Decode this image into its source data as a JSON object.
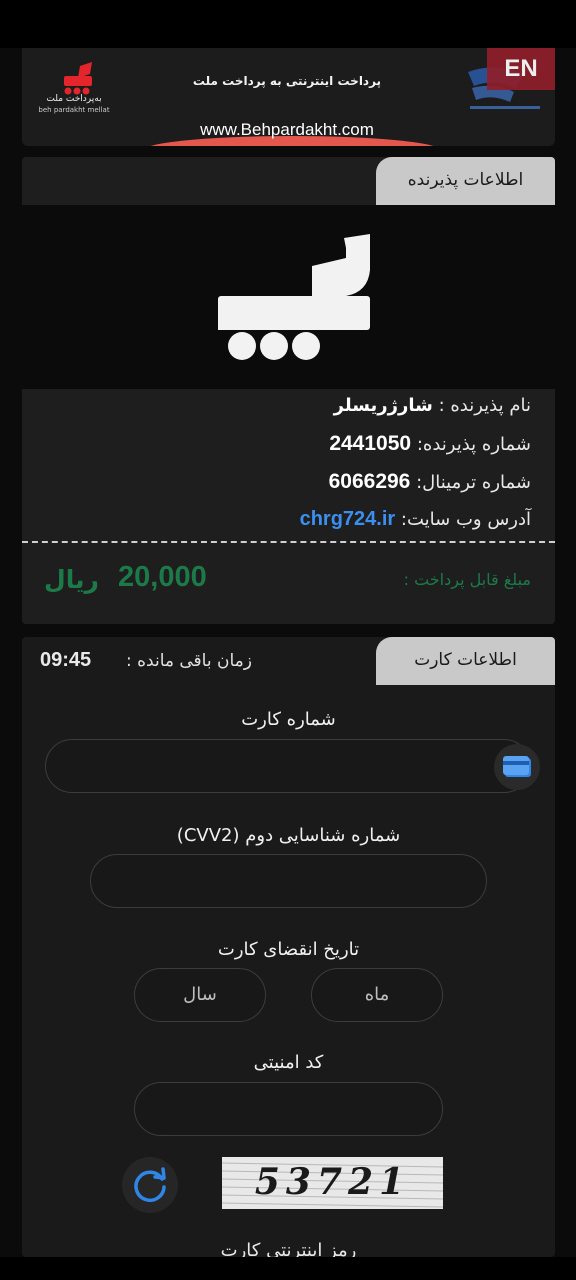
{
  "header": {
    "left_logo_text": "به‌پرداخت ملت",
    "left_logo_sub": "beh pardakht mellat",
    "title": "پرداخت اینترنتی به پرداخت ملت",
    "url": "www.Behpardakht.com",
    "lang_button": "EN"
  },
  "merchant": {
    "section_title": "اطلاعات پذیرنده",
    "name_label": "نام پذیرنده :",
    "name_value": "شارژ‌ریسلر",
    "merchant_no_label": "شماره پذیرنده:",
    "merchant_no_value": "2441050",
    "terminal_label": "شماره ترمینال:",
    "terminal_value": "6066296",
    "website_label": "آدرس وب سایت:",
    "website_value": "chrg724.ir",
    "amount_label": "مبلغ قابل پرداخت :",
    "amount_value": "20,000",
    "amount_unit": "ریال"
  },
  "card_info": {
    "section_title": "اطلاعات کارت",
    "timer_label": "زمان باقی مانده :",
    "timer_value": "09:45",
    "card_number_label": "شماره کارت",
    "cvv2_label": "شماره شناسایی دوم (CVV2)",
    "expiry_label": "تاریخ انقضای کارت",
    "month_placeholder": "ماه",
    "year_placeholder": "سال",
    "security_code_label": "کد امنیتی",
    "captcha_text": "53721",
    "next_label": "رمز اینترنتی کارت"
  },
  "colors": {
    "amount_green": "#1c7a49",
    "link_blue": "#3b8ff0",
    "en_button_bg": "#8e1f2a",
    "accent_blue": "#2f86e6"
  },
  "icons": {
    "card": "credit-card-icon",
    "refresh": "refresh-icon"
  }
}
